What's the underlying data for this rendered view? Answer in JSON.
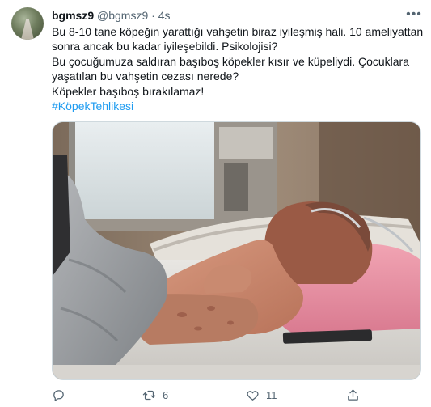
{
  "tweet": {
    "author_name": "bgmsz9",
    "author_handle": "@bgmsz9",
    "separator": "·",
    "time": "4s",
    "text_lines": [
      "Bu 8-10 tane köpeğin yarattığı vahşetin biraz iyileşmiş hali. 10 ameliyattan",
      "sonra ancak bu kadar iyileşebildi. Psikolojisi?",
      "Bu çocuğumuza saldıran başıboş köpekler kısır ve küpeliydi. Çocuklara",
      "yaşatılan bu vahşetin cezası nerede?",
      "Köpekler başıboş bırakılamaz!"
    ],
    "hashtag": "#KöpekTehlikesi"
  },
  "actions": {
    "reply_count": "",
    "retweet_count": "6",
    "like_count": "11"
  },
  "icons": {
    "more": "more-icon",
    "reply": "reply-icon",
    "retweet": "retweet-icon",
    "like": "heart-icon",
    "share": "share-icon"
  },
  "colors": {
    "link": "#1d9bf0",
    "secondary_text": "#536471",
    "primary_text": "#0f1419"
  }
}
